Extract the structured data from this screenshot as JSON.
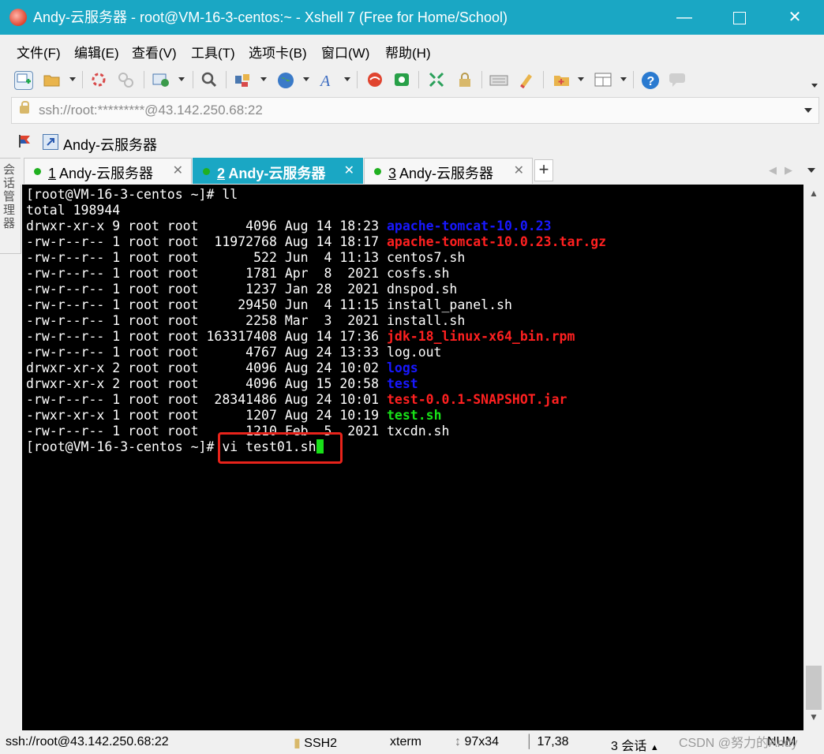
{
  "window": {
    "title": "Andy-云服务器 - root@VM-16-3-centos:~ - Xshell 7 (Free for Home/School)",
    "accent": "#1aa7c4"
  },
  "menu": [
    "文件(F)",
    "编辑(E)",
    "查看(V)",
    "工具(T)",
    "选项卡(B)",
    "窗口(W)",
    "帮助(H)"
  ],
  "toolbar": {
    "icons": [
      "new-session-icon",
      "open-folder-icon",
      "reconnect-icon",
      "disconnect-icon",
      "properties-icon",
      "find-icon",
      "transfer-icon",
      "globe-icon",
      "font-icon",
      "xshell-logo-icon",
      "xftp-icon",
      "fullscreen-icon",
      "lock-icon",
      "keyboard-icon",
      "highlight-icon",
      "new-tab-icon",
      "layout-icon",
      "help-icon",
      "chat-icon"
    ]
  },
  "address": {
    "value": "ssh://root:*********@43.142.250.68:22"
  },
  "links": {
    "label": "Andy-云服务器"
  },
  "side_tab": {
    "label": "会话管理器"
  },
  "tabs": [
    {
      "num": "1",
      "label": " Andy-云服务器",
      "active": false
    },
    {
      "num": "2",
      "label": " Andy-云服务器",
      "active": true
    },
    {
      "num": "3",
      "label": " Andy-云服务器",
      "active": false
    }
  ],
  "terminal": {
    "lines": [
      [
        {
          "t": "[root@VM-16-3-centos ~]# ll",
          "c": ""
        }
      ],
      [
        {
          "t": "total 198944",
          "c": ""
        }
      ],
      [
        {
          "t": "drwxr-xr-x 9 root root      4096 Aug 14 18:23 ",
          "c": ""
        },
        {
          "t": "apache-tomcat-10.0.23",
          "c": "blue"
        }
      ],
      [
        {
          "t": "-rw-r--r-- 1 root root  11972768 Aug 14 18:17 ",
          "c": ""
        },
        {
          "t": "apache-tomcat-10.0.23.tar.gz",
          "c": "red"
        }
      ],
      [
        {
          "t": "-rw-r--r-- 1 root root       522 Jun  4 11:13 centos7.sh",
          "c": ""
        }
      ],
      [
        {
          "t": "-rw-r--r-- 1 root root      1781 Apr  8  2021 cosfs.sh",
          "c": ""
        }
      ],
      [
        {
          "t": "-rw-r--r-- 1 root root      1237 Jan 28  2021 dnspod.sh",
          "c": ""
        }
      ],
      [
        {
          "t": "-rw-r--r-- 1 root root     29450 Jun  4 11:15 install_panel.sh",
          "c": ""
        }
      ],
      [
        {
          "t": "-rw-r--r-- 1 root root      2258 Mar  3  2021 install.sh",
          "c": ""
        }
      ],
      [
        {
          "t": "-rw-r--r-- 1 root root 163317408 Aug 14 17:36 ",
          "c": ""
        },
        {
          "t": "jdk-18_linux-x64_bin.rpm",
          "c": "red"
        }
      ],
      [
        {
          "t": "-rw-r--r-- 1 root root      4767 Aug 24 13:33 log.out",
          "c": ""
        }
      ],
      [
        {
          "t": "drwxr-xr-x 2 root root      4096 Aug 24 10:02 ",
          "c": ""
        },
        {
          "t": "logs",
          "c": "blue"
        }
      ],
      [
        {
          "t": "drwxr-xr-x 2 root root      4096 Aug 15 20:58 ",
          "c": ""
        },
        {
          "t": "test",
          "c": "blue"
        }
      ],
      [
        {
          "t": "-rw-r--r-- 1 root root  28341486 Aug 24 10:01 ",
          "c": ""
        },
        {
          "t": "test-0.0.1-SNAPSHOT.jar",
          "c": "red"
        }
      ],
      [
        {
          "t": "-rwxr-xr-x 1 root root      1207 Aug 24 10:19 ",
          "c": ""
        },
        {
          "t": "test.sh",
          "c": "green"
        }
      ],
      [
        {
          "t": "-rw-r--r-- 1 root root      1210 Feb  5  2021 txcdn.sh",
          "c": ""
        }
      ],
      [
        {
          "t": "[root@VM-16-3-centos ~]# vi test01.sh",
          "c": ""
        },
        {
          "t": "",
          "c": "cursor"
        }
      ]
    ],
    "colors": {
      "background": "#000000",
      "text": "#ffffff",
      "dir": "#1818ff",
      "archive": "#ff2020",
      "exec": "#18e018"
    }
  },
  "status": {
    "connection": "ssh://root@43.142.250.68:22",
    "protocol": "SSH2",
    "terminal_type": "xterm",
    "size": "97x34",
    "cursor_pos": "17,38",
    "sessions": "3 会话",
    "num": "NUM"
  },
  "watermark": "CSDN @努力的Andy"
}
